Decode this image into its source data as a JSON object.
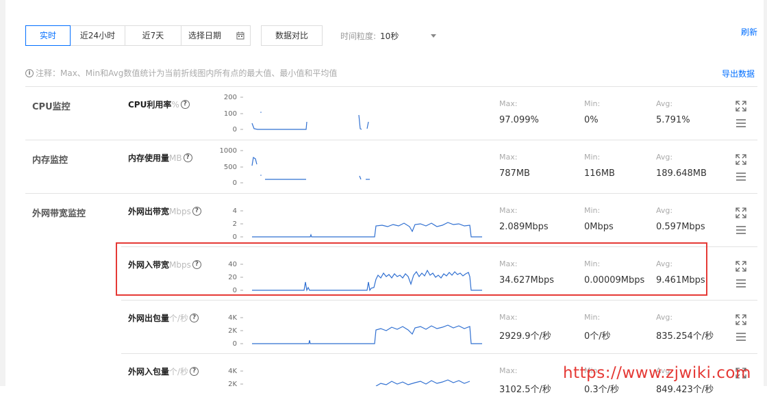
{
  "toolbar": {
    "tabs": [
      "实时",
      "近24小时",
      "近7天"
    ],
    "date_placeholder": "选择日期",
    "compare_label": "数据对比",
    "granularity_label": "时间粒度:",
    "granularity_value": "10秒",
    "refresh_label": "刷新"
  },
  "note": {
    "text": "注释：Max、Min和Avg数值统计为当前折线图内所有点的最大值、最小值和平均值",
    "export_label": "导出数据"
  },
  "groups": {
    "cpu": "CPU监控",
    "mem": "内存监控",
    "net": "外网带宽监控"
  },
  "stat_labels": {
    "max": "Max:",
    "min": "Min:",
    "avg": "Avg:"
  },
  "metrics": [
    {
      "name": "CPU利用率",
      "unit": "%",
      "ticks": [
        "200",
        "100",
        "0"
      ],
      "max": "97.099%",
      "min": "0%",
      "avg": "5.791%"
    },
    {
      "name": "内存使用量",
      "unit": "MB",
      "ticks": [
        "1000",
        "500",
        "0"
      ],
      "max": "787MB",
      "min": "116MB",
      "avg": "189.648MB"
    },
    {
      "name": "外网出带宽",
      "unit": "Mbps",
      "ticks": [
        "4",
        "2",
        "0"
      ],
      "max": "2.089Mbps",
      "min": "0Mbps",
      "avg": "0.597Mbps"
    },
    {
      "name": "外网入带宽",
      "unit": "Mbps",
      "ticks": [
        "40",
        "20",
        "0"
      ],
      "max": "34.627Mbps",
      "min": "0.00009Mbps",
      "avg": "9.461Mbps"
    },
    {
      "name": "外网出包量",
      "unit": "个/秒",
      "ticks": [
        "4K",
        "2K",
        "0"
      ],
      "max": "2929.9个/秒",
      "min": "0个/秒",
      "avg": "835.254个/秒"
    },
    {
      "name": "外网入包量",
      "unit": "个/秒",
      "ticks": [
        "4K",
        "2K"
      ],
      "max": "3102.5个/秒",
      "min": "0.3个/秒",
      "avg": "849.423个/秒"
    }
  ],
  "colors": {
    "accent": "#006eff",
    "line": "#2f6fd1",
    "highlight": "#e53935"
  },
  "watermark": "https://www.zjwiki.com"
}
